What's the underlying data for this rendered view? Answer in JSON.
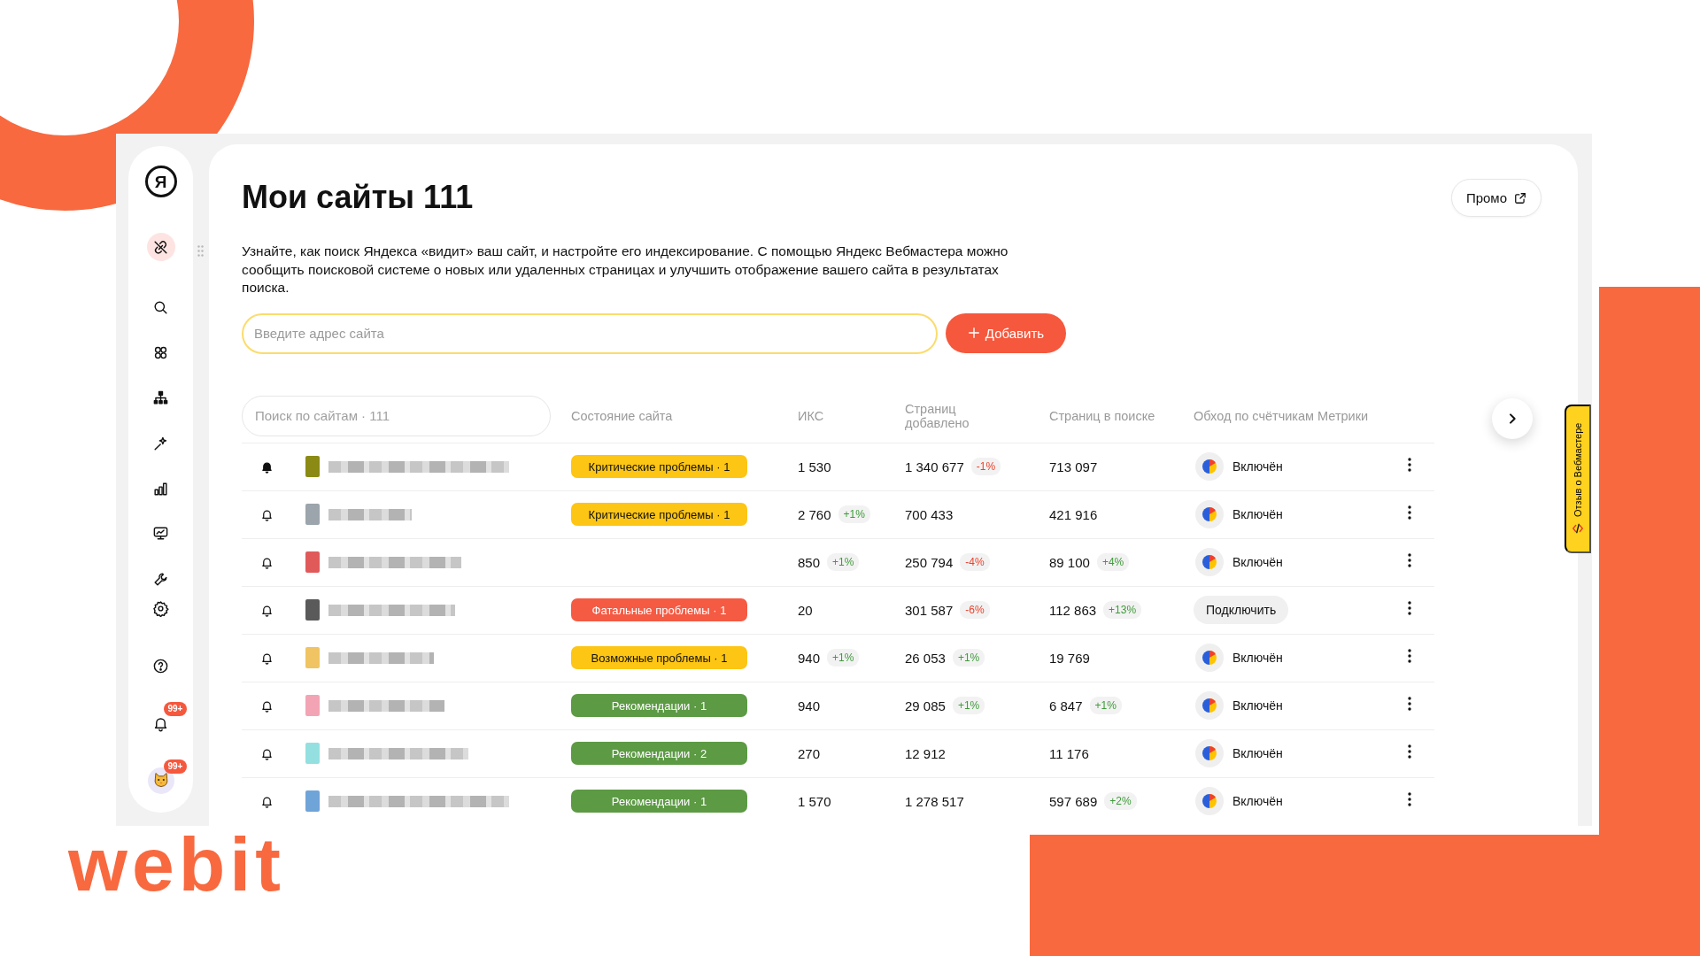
{
  "brand": {
    "logo_text": "webit"
  },
  "app": {
    "sidebar": {
      "logo": "Я",
      "items": [
        {
          "kind": "sites",
          "selected": true
        },
        {
          "kind": "search",
          "selected": false
        },
        {
          "kind": "grid",
          "selected": false
        },
        {
          "kind": "structure",
          "selected": false
        },
        {
          "kind": "wand",
          "selected": false
        },
        {
          "kind": "chart",
          "selected": false
        },
        {
          "kind": "monitor",
          "selected": false
        },
        {
          "kind": "wrench",
          "selected": false
        },
        {
          "kind": "gear",
          "selected": false
        },
        {
          "kind": "help",
          "selected": false
        },
        {
          "kind": "bell",
          "selected": false,
          "badge": "99+"
        },
        {
          "kind": "avatar",
          "selected": false,
          "badge": "99+"
        }
      ]
    },
    "header": {
      "title": "Мои сайты 111",
      "promo_button": "Промо"
    },
    "description": "Узнайте, как поиск Яндекса «видит» ваш сайт, и настройте его индексирование. С помощью Яндекс Вебмастера можно сообщить поисковой системе о новых или удаленных страницах и улучшить отображение вашего сайта в результатах поиска.",
    "add_site": {
      "placeholder": "Введите адрес сайта",
      "button": "Добавить"
    },
    "table": {
      "search": {
        "placeholder": "Поиск по сайтам · 111"
      },
      "columns": [
        "Состояние сайта",
        "ИКС",
        "Страниц добавлено",
        "Страниц в поиске",
        "Обход по счётчикам Метрики"
      ],
      "rows": [
        {
          "notifications": true,
          "color": "#8a8a14",
          "status": {
            "kind": "critical",
            "text": "Критические проблемы · 1"
          },
          "iks": {
            "value": "1 530"
          },
          "pages_added": {
            "value": "1 340 677",
            "delta": {
              "kind": "down",
              "text": "-1%"
            }
          },
          "pages_in_search": {
            "value": "713 097"
          },
          "metrika": {
            "kind": "status",
            "text": "Включён"
          }
        },
        {
          "notifications": false,
          "color": "#9ba5ab",
          "status": {
            "kind": "critical",
            "text": "Критические проблемы · 1"
          },
          "iks": {
            "value": "2 760",
            "delta": {
              "kind": "up",
              "text": "+1%"
            }
          },
          "pages_added": {
            "value": "700 433"
          },
          "pages_in_search": {
            "value": "421 916"
          },
          "metrika": {
            "kind": "status",
            "text": "Включён"
          }
        },
        {
          "notifications": false,
          "color": "#e05a5a",
          "iks": {
            "value": "850",
            "delta": {
              "kind": "up",
              "text": "+1%"
            }
          },
          "pages_added": {
            "value": "250 794",
            "delta": {
              "kind": "down",
              "text": "-4%"
            }
          },
          "pages_in_search": {
            "value": "89 100",
            "delta": {
              "kind": "up",
              "text": "+4%"
            }
          },
          "metrika": {
            "kind": "status",
            "text": "Включён"
          }
        },
        {
          "notifications": false,
          "color": "#5a5a5a",
          "status": {
            "kind": "fatal",
            "text": "Фатальные проблемы · 1"
          },
          "iks": {
            "value": "20"
          },
          "pages_added": {
            "value": "301 587",
            "delta": {
              "kind": "down",
              "text": "-6%"
            }
          },
          "pages_in_search": {
            "value": "112 863",
            "delta": {
              "kind": "up",
              "text": "+13%"
            }
          },
          "metrika": {
            "kind": "button",
            "text": "Подключить"
          }
        },
        {
          "notifications": false,
          "color": "#f0c462",
          "status": {
            "kind": "possible",
            "text": "Возможные проблемы · 1"
          },
          "iks": {
            "value": "940",
            "delta": {
              "kind": "up",
              "text": "+1%"
            }
          },
          "pages_added": {
            "value": "26 053",
            "delta": {
              "kind": "up",
              "text": "+1%"
            }
          },
          "pages_in_search": {
            "value": "19 769"
          },
          "metrika": {
            "kind": "status",
            "text": "Включён"
          }
        },
        {
          "notifications": false,
          "color": "#f2a4b4",
          "status": {
            "kind": "recommendation",
            "text": "Рекомендации · 1"
          },
          "iks": {
            "value": "940"
          },
          "pages_added": {
            "value": "29 085",
            "delta": {
              "kind": "up",
              "text": "+1%"
            }
          },
          "pages_in_search": {
            "value": "6 847",
            "delta": {
              "kind": "up",
              "text": "+1%"
            }
          },
          "metrika": {
            "kind": "status",
            "text": "Включён"
          }
        },
        {
          "notifications": false,
          "color": "#94e0e0",
          "status": {
            "kind": "recommendation",
            "text": "Рекомендации · 2"
          },
          "iks": {
            "value": "270"
          },
          "pages_added": {
            "value": "12 912"
          },
          "pages_in_search": {
            "value": "11 176"
          },
          "metrika": {
            "kind": "status",
            "text": "Включён"
          }
        },
        {
          "notifications": false,
          "color": "#6fa4d8",
          "status": {
            "kind": "recommendation",
            "text": "Рекомендации · 1"
          },
          "iks": {
            "value": "1 570"
          },
          "pages_added": {
            "value": "1 278 517"
          },
          "pages_in_search": {
            "value": "597 689",
            "delta": {
              "kind": "up",
              "text": "+2%"
            }
          },
          "metrika": {
            "kind": "status",
            "text": "Включён"
          }
        }
      ]
    },
    "feedback_tab": "Отзыв о Вебмастере"
  }
}
